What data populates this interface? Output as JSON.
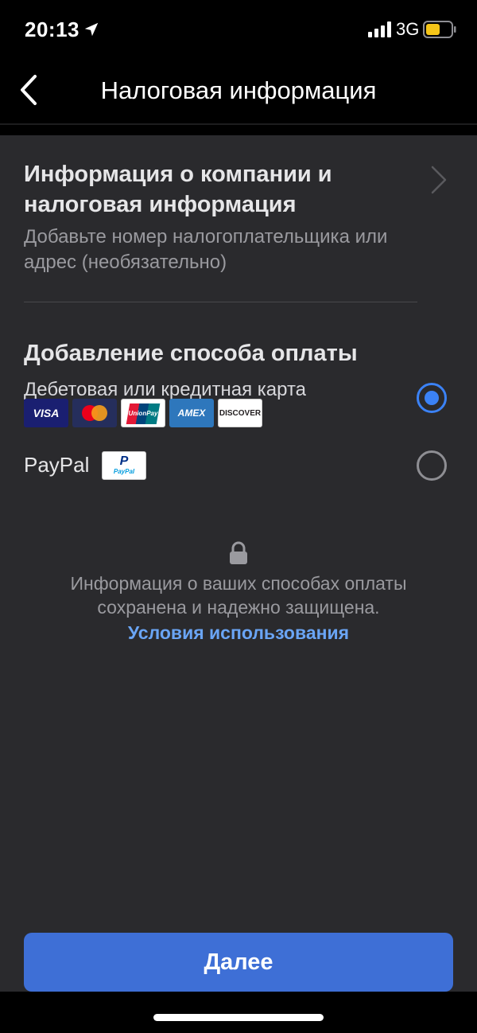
{
  "status_bar": {
    "time": "20:13",
    "network": "3G",
    "icons": [
      "location-arrow-icon",
      "signal-bars-icon",
      "battery-icon"
    ]
  },
  "header": {
    "title": "Налоговая информация",
    "back_icon": "chevron-left-icon"
  },
  "company_info": {
    "title": "Информация о компании и налоговая информация",
    "subtitle": "Добавьте номер налогоплательщика или адрес (необязательно)",
    "icon": "chevron-right-icon"
  },
  "payment_methods": {
    "title": "Добавление способа оплаты",
    "options": [
      {
        "label": "Дебетовая или кредитная карта",
        "selected": true,
        "logos": [
          "VISA",
          "Mastercard",
          "UnionPay",
          "AMEX",
          "DISCOVER"
        ]
      },
      {
        "label": "PayPal",
        "selected": false,
        "logos": [
          "PayPal"
        ]
      }
    ]
  },
  "security": {
    "icon": "lock-icon",
    "text": "Информация о ваших способах оплаты сохранена и надежно защищена.",
    "terms_link": "Условия использования"
  },
  "footer": {
    "next_button": "Далее"
  },
  "colors": {
    "accent": "#3e6fd6",
    "radio_selected": "#3b82f6",
    "link": "#6aa5f5",
    "background": "#2a2a2d"
  }
}
